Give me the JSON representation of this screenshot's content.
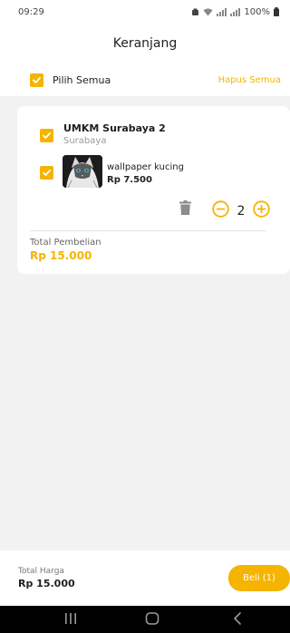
{
  "status_bar": {
    "time": "09:29",
    "battery": "100%"
  },
  "header": {
    "title": "Keranjang"
  },
  "select_all": {
    "label": "Pilih Semua",
    "delete_all_label": "Hapus Semua",
    "checked": true
  },
  "cart": {
    "shop": {
      "name": "UMKM Surabaya 2",
      "city": "Surabaya",
      "checked": true
    },
    "items": [
      {
        "name": "wallpaper kucing",
        "price": "Rp 7.500",
        "quantity": "2",
        "checked": true,
        "image": "cat-wallpaper-thumbnail"
      }
    ],
    "total_label": "Total Pembelian",
    "total_value": "Rp 15.000"
  },
  "bottom_bar": {
    "total_label": "Total Harga",
    "total_value": "Rp 15.000",
    "buy_label": "Beli (1)"
  },
  "navigation": {
    "icons": [
      "recent-apps-icon",
      "home-icon",
      "back-icon"
    ]
  },
  "colors": {
    "accent": "#f5b400",
    "background": "#f2f2f2",
    "surface": "#ffffff",
    "nav_bar": "#000000"
  }
}
